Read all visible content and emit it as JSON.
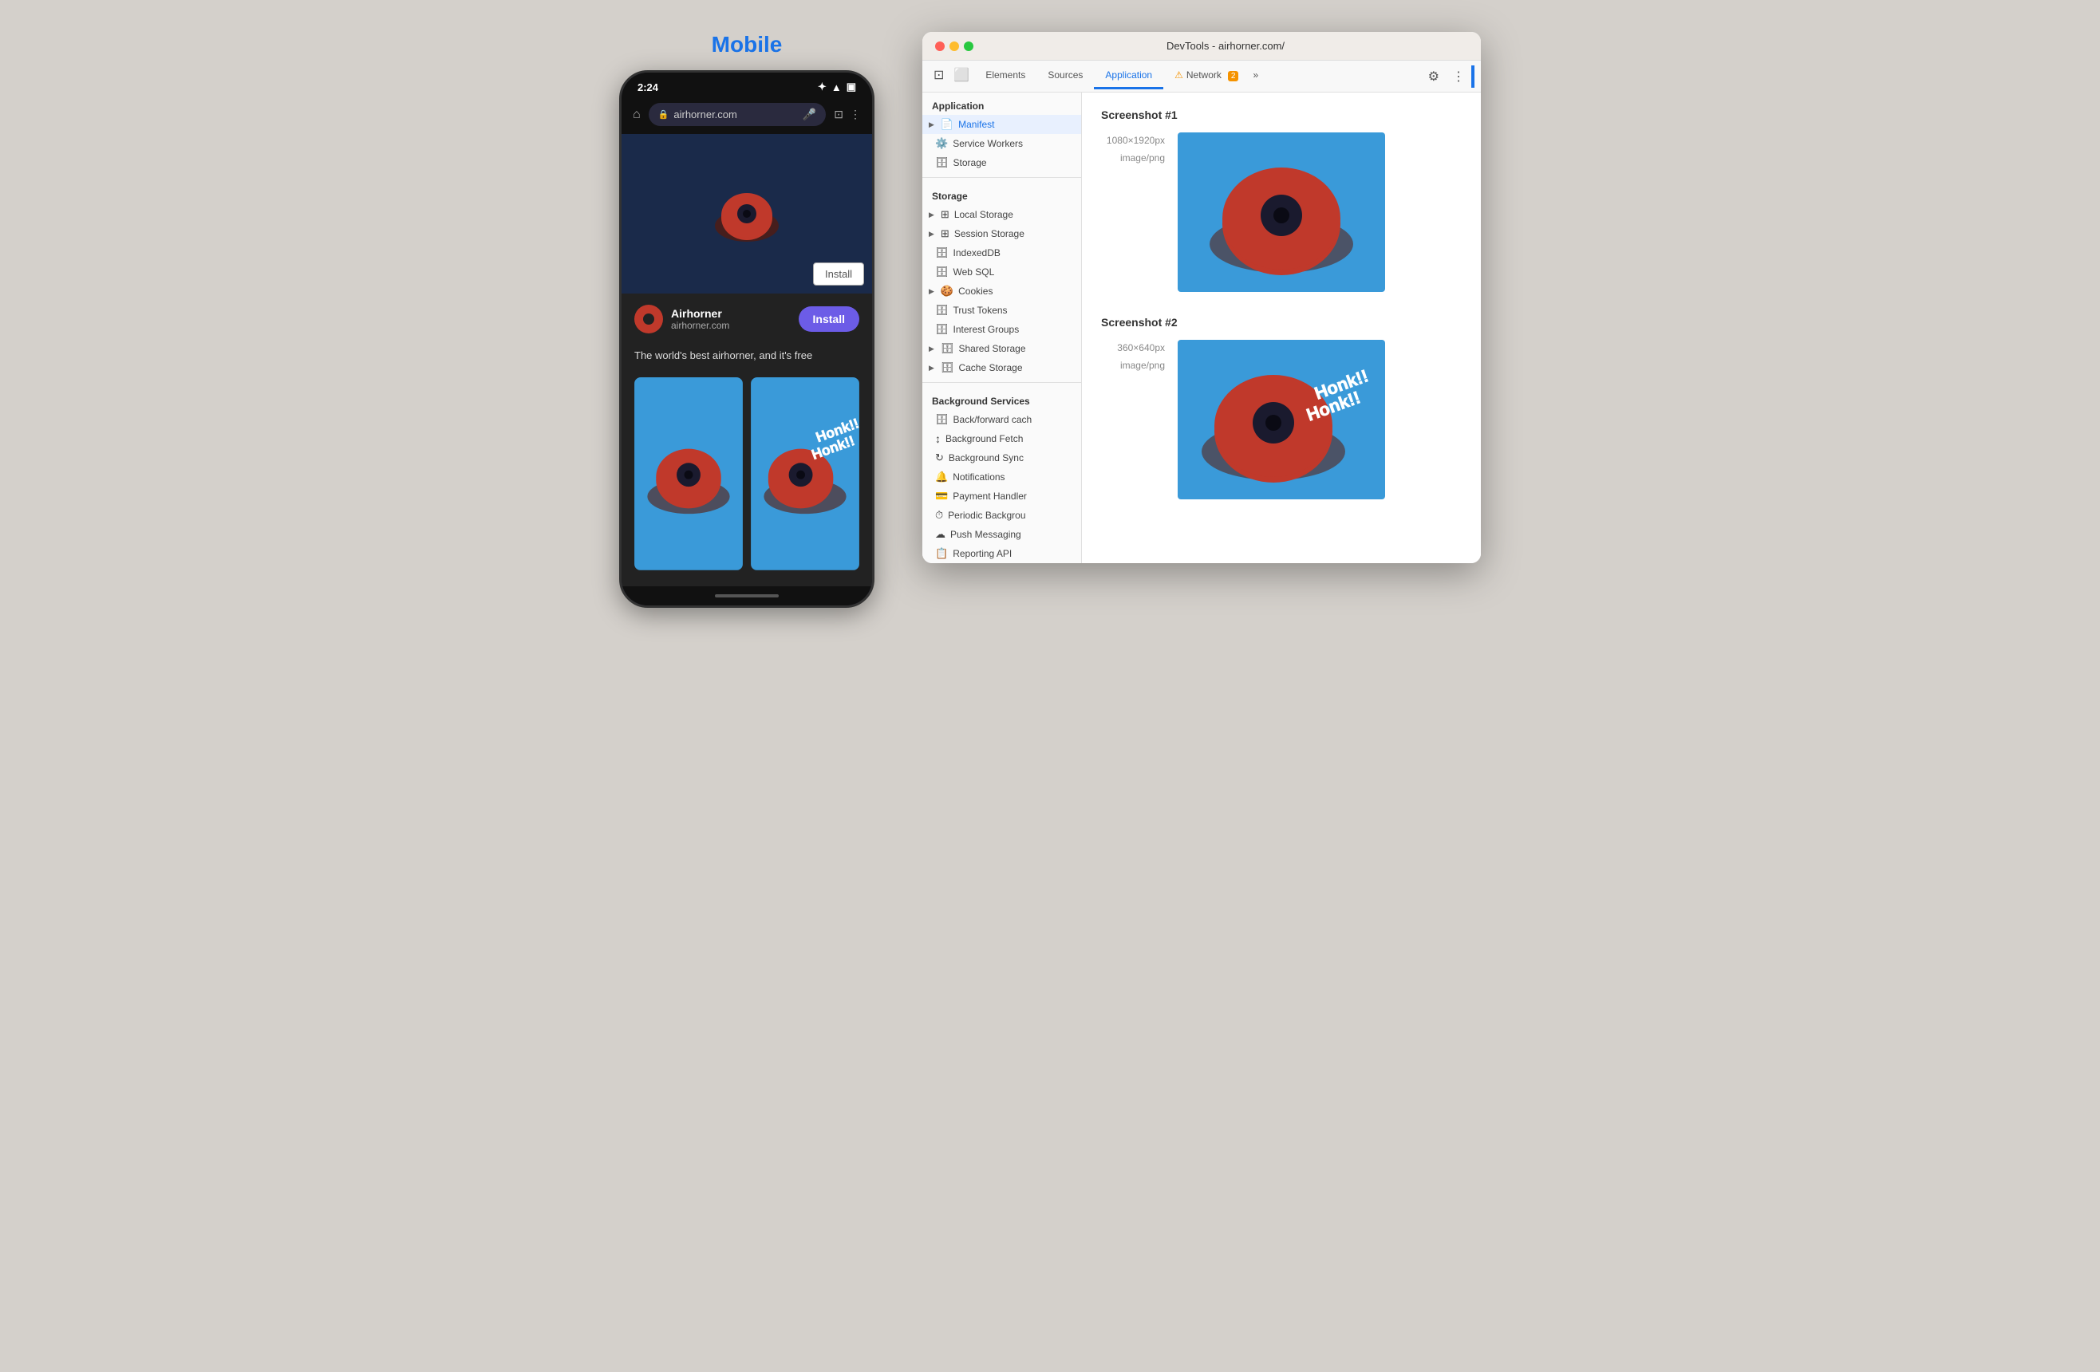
{
  "mobile": {
    "label": "Mobile",
    "statusbar": {
      "time": "2:24",
      "icons": [
        "bluetooth",
        "wifi",
        "battery"
      ]
    },
    "addressbar": {
      "url": "airhorner.com"
    },
    "install_btn_top": "Install",
    "banner": {
      "app_name": "Airhorner",
      "domain": "airhorner.com",
      "install_label": "Install"
    },
    "tagline": "The world's best airhorner, and it's free"
  },
  "devtools": {
    "title": "DevTools - airhorner.com/",
    "tabs": [
      {
        "id": "elements",
        "label": "Elements",
        "active": false
      },
      {
        "id": "sources",
        "label": "Sources",
        "active": false
      },
      {
        "id": "application",
        "label": "Application",
        "active": true
      },
      {
        "id": "network",
        "label": "Network",
        "active": false,
        "warn": true,
        "warn_count": "2"
      }
    ],
    "sidebar": {
      "sections": [
        {
          "label": "Application",
          "items": [
            {
              "id": "manifest",
              "label": "Manifest",
              "icon": "📄",
              "arrow": true,
              "active": true
            },
            {
              "id": "service-workers",
              "label": "Service Workers",
              "icon": "⚙️"
            },
            {
              "id": "storage",
              "label": "Storage",
              "icon": "🗄"
            }
          ]
        },
        {
          "label": "Storage",
          "items": [
            {
              "id": "local-storage",
              "label": "Local Storage",
              "icon": "⊞",
              "arrow": true
            },
            {
              "id": "session-storage",
              "label": "Session Storage",
              "icon": "⊞",
              "arrow": true
            },
            {
              "id": "indexeddb",
              "label": "IndexedDB",
              "icon": "🗄"
            },
            {
              "id": "web-sql",
              "label": "Web SQL",
              "icon": "🗄"
            },
            {
              "id": "cookies",
              "label": "Cookies",
              "icon": "🍪",
              "arrow": true
            },
            {
              "id": "trust-tokens",
              "label": "Trust Tokens",
              "icon": "🗄"
            },
            {
              "id": "interest-groups",
              "label": "Interest Groups",
              "icon": "🗄"
            },
            {
              "id": "shared-storage",
              "label": "Shared Storage",
              "icon": "🗄",
              "arrow": true
            },
            {
              "id": "cache-storage",
              "label": "Cache Storage",
              "icon": "🗄",
              "arrow": true
            }
          ]
        },
        {
          "label": "Background Services",
          "items": [
            {
              "id": "back-forward-cache",
              "label": "Back/forward cach",
              "icon": "🗄"
            },
            {
              "id": "background-fetch",
              "label": "Background Fetch",
              "icon": "↕"
            },
            {
              "id": "background-sync",
              "label": "Background Sync",
              "icon": "↻"
            },
            {
              "id": "notifications",
              "label": "Notifications",
              "icon": "🔔"
            },
            {
              "id": "payment-handler",
              "label": "Payment Handler",
              "icon": "💳"
            },
            {
              "id": "periodic-background",
              "label": "Periodic Backgrou",
              "icon": "⏱"
            },
            {
              "id": "push-messaging",
              "label": "Push Messaging",
              "icon": "☁"
            },
            {
              "id": "reporting-api",
              "label": "Reporting API",
              "icon": "📋"
            }
          ]
        }
      ]
    },
    "main": {
      "screenshots": [
        {
          "title": "Screenshot #1",
          "dimensions": "1080×1920px",
          "format": "image/png",
          "type": "portrait-plain"
        },
        {
          "title": "Screenshot #2",
          "dimensions": "360×640px",
          "format": "image/png",
          "type": "portrait-honk"
        }
      ]
    }
  }
}
